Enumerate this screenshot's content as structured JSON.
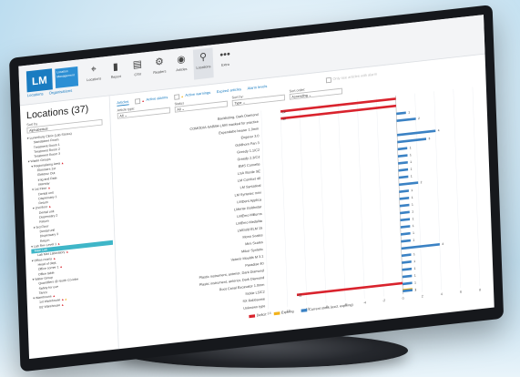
{
  "app": {
    "logo": "LM",
    "logo_sub": "Location Management",
    "nav_links": [
      "Locations",
      "Organisations"
    ],
    "tools": [
      {
        "label": "Locations",
        "icon": "map-pin-icon",
        "glyph": "⌖",
        "active": false
      },
      {
        "label": "Report",
        "icon": "bar-chart-icon",
        "glyph": "▮",
        "active": false
      },
      {
        "label": "CSV",
        "icon": "document-icon",
        "glyph": "▤",
        "active": false
      },
      {
        "label": "Readers",
        "icon": "reader-icon",
        "glyph": "⚙",
        "active": false
      },
      {
        "label": "Articles",
        "icon": "eye-icon",
        "glyph": "◉",
        "active": false
      },
      {
        "label": "Locations",
        "icon": "location-icon",
        "glyph": "⚲",
        "active": true
      },
      {
        "label": "Extra",
        "icon": "more-icon",
        "glyph": "•••",
        "active": false
      }
    ]
  },
  "sidebar": {
    "title": "Locations (37)",
    "sort_label": "Sort by",
    "sort_value": "Alphabetical",
    "tree": [
      {
        "label": "▾ Lunenburg Clinic (Lab Stores)",
        "indent": 0,
        "flag": ""
      },
      {
        "label": "Standalone Room",
        "indent": 2,
        "flag": ""
      },
      {
        "label": "Treatment Room 1",
        "indent": 2,
        "flag": ""
      },
      {
        "label": "Treatment Room 2",
        "indent": 2,
        "flag": ""
      },
      {
        "label": "Treatment Room 3",
        "indent": 2,
        "flag": ""
      },
      {
        "label": "▾ Waste Groups",
        "indent": 0,
        "flag": ""
      },
      {
        "label": "▾ Regionalizing Area",
        "indent": 1,
        "flag": "red"
      },
      {
        "label": "Eliminers 1st",
        "indent": 3,
        "flag": ""
      },
      {
        "label": "Elektroz Out",
        "indent": 3,
        "flag": ""
      },
      {
        "label": "Irrig and Rate",
        "indent": 3,
        "flag": ""
      },
      {
        "label": "Intertray",
        "indent": 3,
        "flag": ""
      },
      {
        "label": "▾ 1st Floor",
        "indent": 1,
        "flag": "red"
      },
      {
        "label": "Dental unit",
        "indent": 3,
        "flag": ""
      },
      {
        "label": "Dispensary 1",
        "indent": 3,
        "flag": ""
      },
      {
        "label": "Return",
        "indent": 3,
        "flag": ""
      },
      {
        "label": "▾ 2nd floor",
        "indent": 1,
        "flag": "red"
      },
      {
        "label": "Dental unit",
        "indent": 3,
        "flag": ""
      },
      {
        "label": "Dispensary 2",
        "indent": 3,
        "flag": ""
      },
      {
        "label": "Return",
        "indent": 3,
        "flag": ""
      },
      {
        "label": "▾ 3rd Floor",
        "indent": 1,
        "flag": ""
      },
      {
        "label": "Dental unit",
        "indent": 3,
        "flag": ""
      },
      {
        "label": "Dispensary 3",
        "indent": 3,
        "flag": ""
      },
      {
        "label": "Return",
        "indent": 3,
        "flag": ""
      },
      {
        "label": "▾ Lab Rev Level 1",
        "indent": 0,
        "flag": "red"
      },
      {
        "label": "Main Lab",
        "indent": 1,
        "flag": "",
        "selected": true
      },
      {
        "label": "Lab Met Laboratory",
        "indent": 2,
        "flag": "red"
      },
      {
        "label": "▾ Office rooms",
        "indent": 0,
        "flag": "red"
      },
      {
        "label": "Head of dept.",
        "indent": 2,
        "flag": ""
      },
      {
        "label": "Office corner 1",
        "indent": 2,
        "flag": "red"
      },
      {
        "label": "Office table",
        "indent": 2,
        "flag": ""
      },
      {
        "label": "▾ Water Group",
        "indent": 0,
        "flag": ""
      },
      {
        "label": "Quantifiers @ North Co-lobe",
        "indent": 2,
        "flag": ""
      },
      {
        "label": "Safety for use",
        "indent": 2,
        "flag": ""
      },
      {
        "label": "Tanco",
        "indent": 2,
        "flag": ""
      },
      {
        "label": "▾ Warehouse",
        "indent": 0,
        "flag": "red"
      },
      {
        "label": "1st Warehouse",
        "indent": 2,
        "flag": "both"
      },
      {
        "label": "B2 Warehouse",
        "indent": 2,
        "flag": "red"
      }
    ]
  },
  "main": {
    "filter_tabs": [
      {
        "label": "Articles",
        "active": true,
        "check": false
      },
      {
        "label": "Active alarms",
        "active": false,
        "check": true,
        "tri": "red"
      },
      {
        "label": "Active warnings",
        "active": false,
        "check": true,
        "tri": "yellow"
      },
      {
        "label": "Expired articles",
        "active": false,
        "check": false
      },
      {
        "label": "Alarm levels",
        "active": false,
        "check": false
      }
    ],
    "selects": [
      {
        "label": "Article type:",
        "value": "All"
      },
      {
        "label": "Status",
        "value": "All"
      },
      {
        "label": "Sort by:",
        "value": "Type"
      },
      {
        "label": "Sort order:",
        "value": "Ascending"
      }
    ],
    "extra_toggle": "Only see articles with alarm"
  },
  "chart_data": {
    "type": "bar",
    "orientation": "horizontal",
    "categories": [
      "Backlisting, Dark Diamond",
      "COMODIA-SAB8H-LNM masked for practice",
      "Expendabe bearer 1.0mm",
      "Engerer 3.0",
      "Goldhorn Fan 3",
      "Greedy 1.1/C2",
      "Greedy 2.3/C4",
      "EMS Cornette",
      "LSA Sterile SE",
      "LM Comfort 40",
      "LM Syntatical",
      "LM Syntetec mini",
      "LMDent Applica",
      "LMente Goldnstar",
      "LMEmo Millurns",
      "LMEmo Medalita",
      "LMGold ELM 15",
      "Mono Scales",
      "Mini Scales",
      "Mikor Syntetic",
      "Vetenir Moulds M 3.1",
      "Paradise 40",
      "Plastic instrument, anterior, Dark Diamond",
      "Plastic instrument, anterior, Dark Diamond",
      "Root Canal Excavator 1.0mm",
      "Sickle L5/C2",
      "SX Rabbsome",
      "Unknown type"
    ],
    "series": [
      {
        "name": "Deficit",
        "color": "#d9232d",
        "values": [
          -12,
          -12,
          0,
          0,
          0,
          0,
          0,
          0,
          0,
          0,
          0,
          0,
          0,
          0,
          0,
          0,
          0,
          0,
          0,
          0,
          0,
          0,
          0,
          0,
          0,
          0,
          -11,
          0
        ]
      },
      {
        "name": "Expiring",
        "color": "#f2b21b",
        "values": [
          0,
          0,
          0,
          0,
          0,
          0,
          0,
          0,
          0,
          0,
          0,
          0,
          0,
          0,
          0,
          0,
          0,
          0,
          0,
          0,
          0,
          0,
          0,
          0,
          0,
          0,
          0,
          1
        ]
      },
      {
        "name": "Current stock (excl. expiring)",
        "color": "#3b82c4",
        "values": [
          0,
          0,
          1,
          2,
          0,
          4,
          3,
          1,
          1,
          1,
          1,
          1,
          2,
          1,
          1,
          1,
          1,
          1,
          1,
          1,
          1,
          4,
          1,
          1,
          1,
          1,
          1,
          1
        ]
      }
    ],
    "xlim": [
      -14,
      8
    ],
    "x_ticks": [
      -14,
      -12,
      -10,
      -8,
      -6,
      -4,
      -2,
      0,
      2,
      4,
      6,
      8
    ],
    "legend_position": "bottom"
  }
}
